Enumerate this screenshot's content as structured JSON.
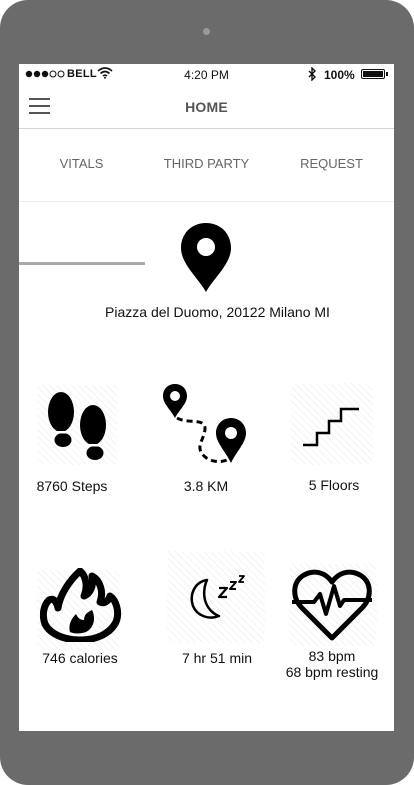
{
  "status_bar": {
    "carrier": "BELL",
    "time": "4:20 PM",
    "battery": "100%",
    "icons": [
      "signal-dots-icon",
      "wifi-icon",
      "bluetooth-icon",
      "battery-icon"
    ]
  },
  "header": {
    "title": "HOME",
    "menu_icon": "hamburger-menu-icon"
  },
  "tabs": [
    {
      "label": "VITALS",
      "active": true
    },
    {
      "label": "THIRD PARTY",
      "active": false
    },
    {
      "label": "REQUEST",
      "active": false
    }
  ],
  "location": {
    "icon": "map-pin-icon",
    "address": "Piazza del Duomo, 20122 Milano MI"
  },
  "vitals": {
    "steps": {
      "icon": "footprints-icon",
      "text": "8760 Steps"
    },
    "distance": {
      "icon": "route-pins-icon",
      "text": "3.8 KM"
    },
    "floors": {
      "icon": "stairs-icon",
      "text": "5 Floors"
    },
    "calories": {
      "icon": "flame-icon",
      "text": "746 calories"
    },
    "sleep": {
      "icon": "moon-zzz-icon",
      "text": "7 hr 51 min"
    },
    "heart": {
      "icon": "heart-pulse-icon",
      "text_line1": "83 bpm",
      "text_line2": "68 bpm resting"
    }
  }
}
